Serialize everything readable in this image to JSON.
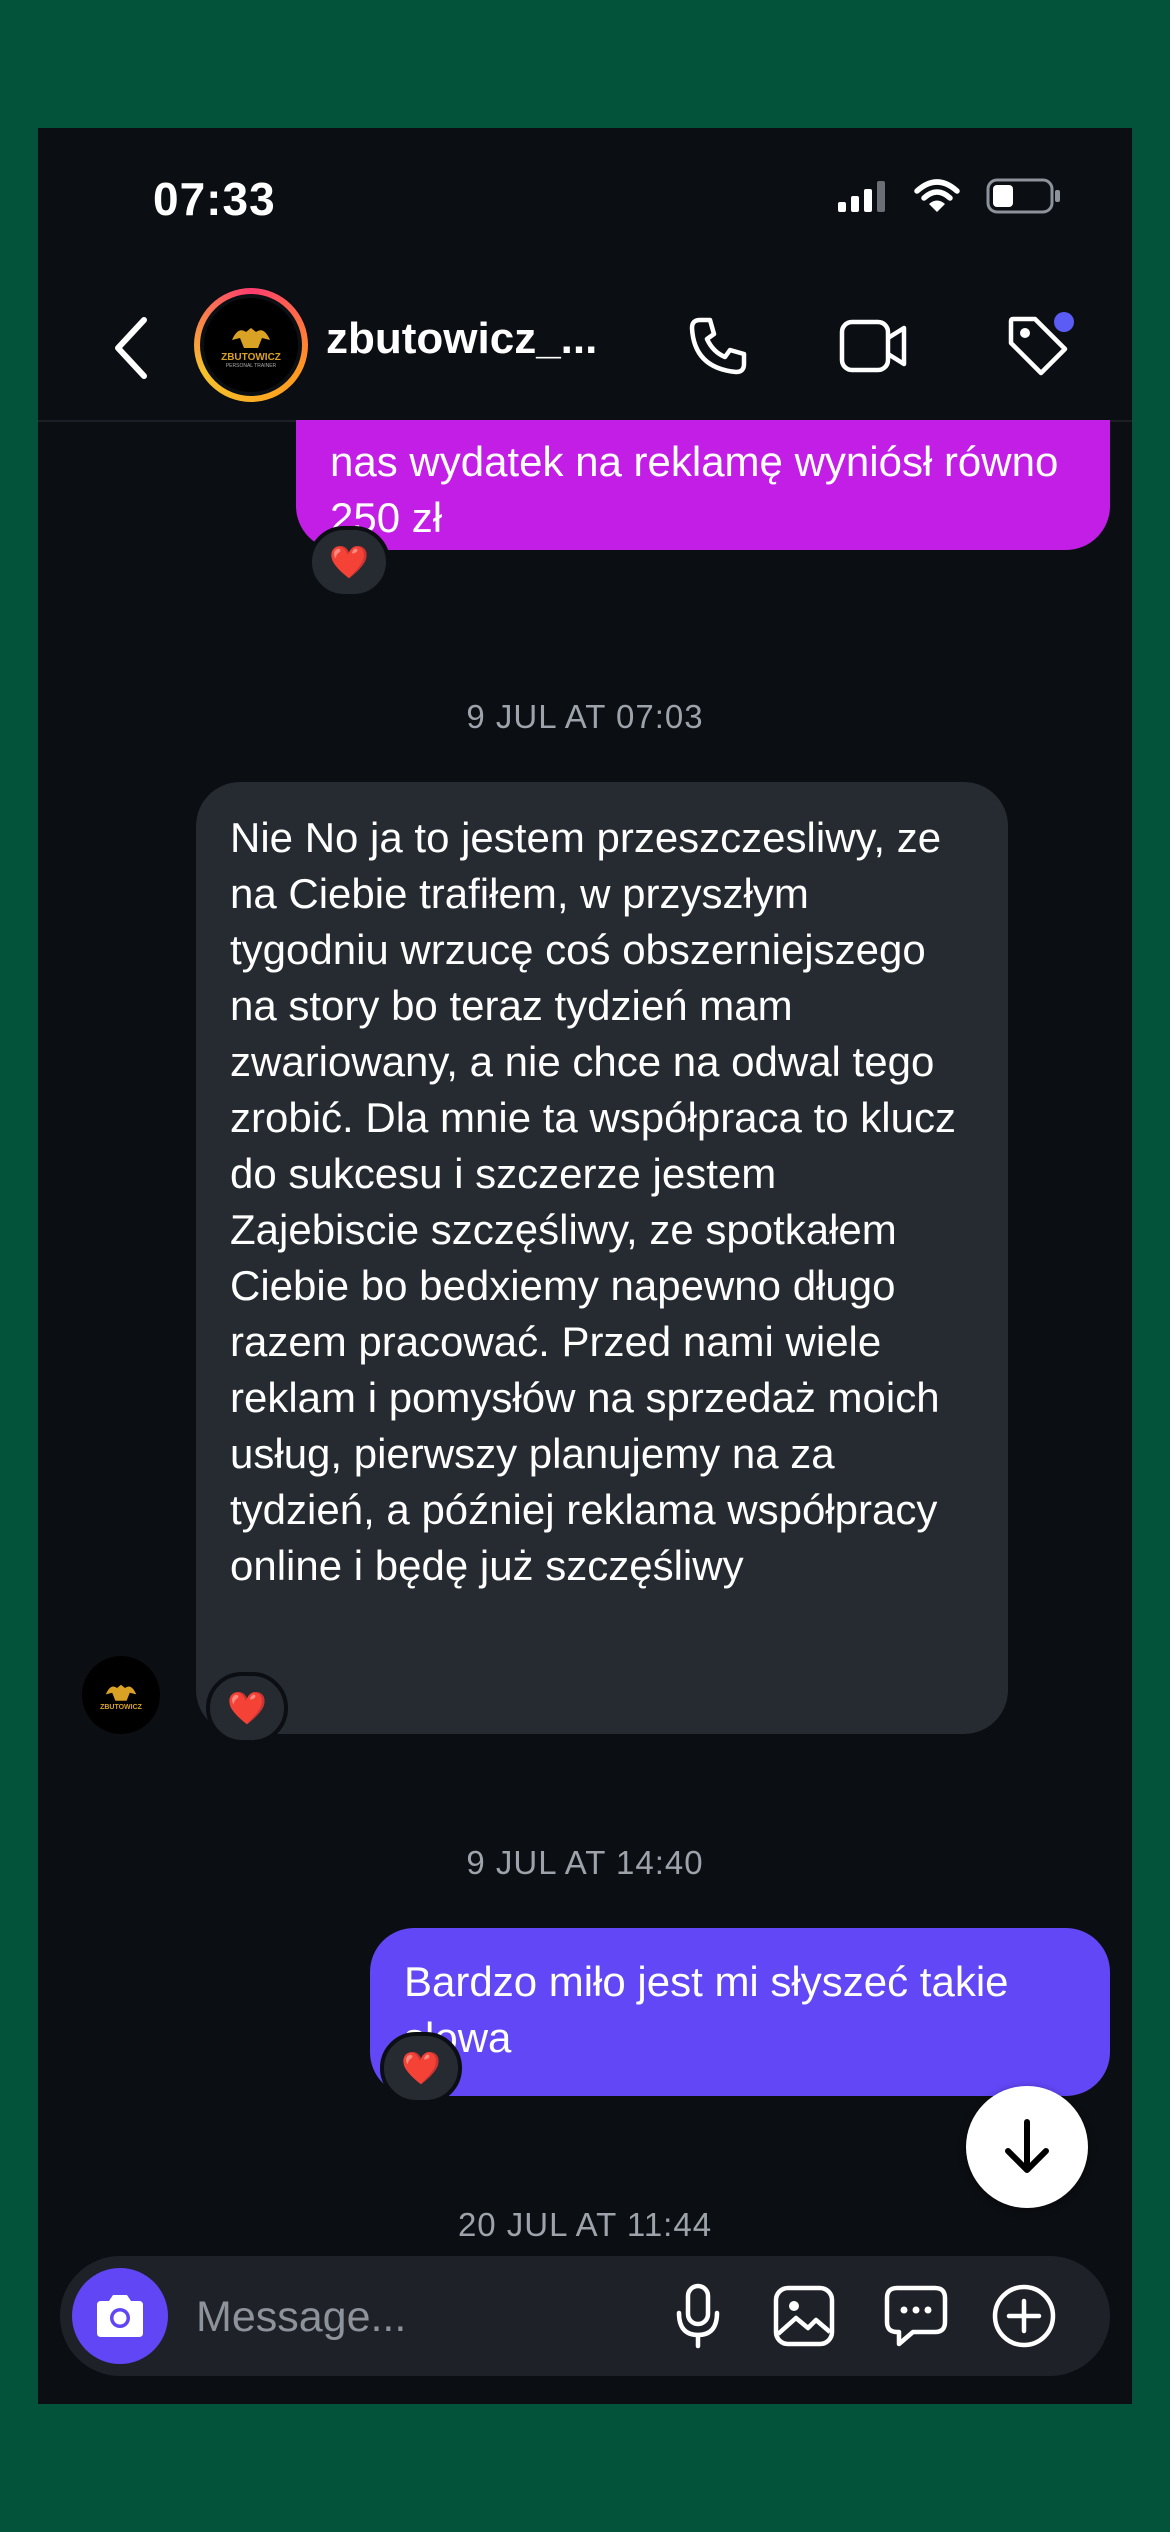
{
  "status_bar": {
    "time": "07:33"
  },
  "header": {
    "username": "zbutowicz_...",
    "avatar_text_top": "ZBUTOWICZ",
    "avatar_text_bottom": "PERSONAL TRAINER"
  },
  "messages": [
    {
      "sender": "me",
      "text": "nas wydatek na reklamę wyniósł równo 250 zł",
      "color": "#c21ee6",
      "reaction": "❤️"
    },
    {
      "sender": "them",
      "text": "Nie No ja to jestem przeszczesliwy, ze na Ciebie trafiłem, w przyszłym tygodniu wrzucę coś obszerniejszego na story bo teraz tydzień mam zwariowany, a nie chce na odwal tego zrobić. Dla mnie ta współpraca to klucz do sukcesu i szczerze jestem Zajebiscie szczęśliwy, ze spotkałem Ciebie bo bedxiemy napewno długo razem pracować. Przed nami wiele reklam i pomysłów na sprzedaż moich usług, pierwszy planujemy na za tydzień, a później reklama współpracy online i będę już szczęśliwy",
      "color": "#262a31",
      "reaction": "❤️"
    },
    {
      "sender": "me",
      "text": "Bardzo miło jest mi słyszeć takie słowa",
      "color": "#6147f6",
      "reaction": "❤️"
    }
  ],
  "timestamps": [
    "9 JUL AT 07:03",
    "9 JUL AT 14:40",
    "20 JUL AT 11:44"
  ],
  "composer": {
    "placeholder": "Message..."
  },
  "colors": {
    "accent": "#6046f5",
    "background": "#0b0e12",
    "frame": "#02533a"
  }
}
